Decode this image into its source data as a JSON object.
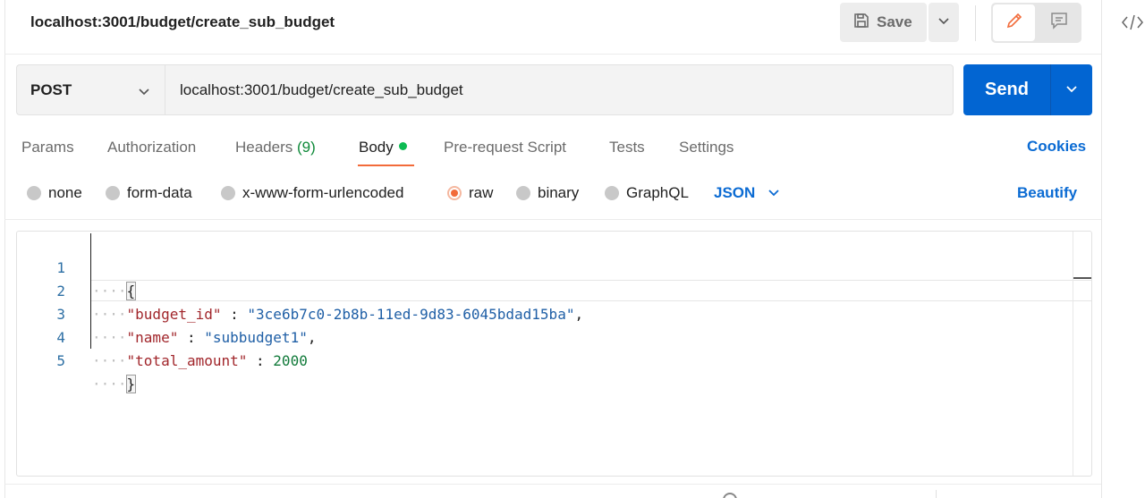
{
  "header": {
    "title": "localhost:3001/budget/create_sub_budget",
    "save_label": "Save"
  },
  "request": {
    "method": "POST",
    "url": "localhost:3001/budget/create_sub_budget",
    "send_label": "Send"
  },
  "tabs": [
    {
      "label": "Params"
    },
    {
      "label": "Authorization"
    },
    {
      "label": "Headers",
      "count": "(9)"
    },
    {
      "label": "Body",
      "active": true
    },
    {
      "label": "Pre-request Script"
    },
    {
      "label": "Tests"
    },
    {
      "label": "Settings"
    }
  ],
  "cookies_label": "Cookies",
  "body_types": [
    {
      "label": "none"
    },
    {
      "label": "form-data"
    },
    {
      "label": "x-www-form-urlencoded"
    },
    {
      "label": "raw",
      "selected": true
    },
    {
      "label": "binary"
    },
    {
      "label": "GraphQL"
    }
  ],
  "format_label": "JSON",
  "beautify_label": "Beautify",
  "editor": {
    "line_numbers": [
      "1",
      "2",
      "3",
      "4",
      "5"
    ],
    "indent": "····",
    "open_brace": "{",
    "close_brace": "}",
    "key1": "\"budget_id\"",
    "val1": "\"3ce6b7c0-2b8b-11ed-9d83-6045bdad15ba\"",
    "key2": "\"name\"",
    "val2": "\"subbudget1\"",
    "key3": "\"total_amount\"",
    "val3": "2000",
    "colon_sep": " : ",
    "comma": ","
  },
  "colors": {
    "send": "#0265d2",
    "accent": "#f26b3a",
    "link": "#0b6bd3",
    "dot": "#0cbb52"
  }
}
